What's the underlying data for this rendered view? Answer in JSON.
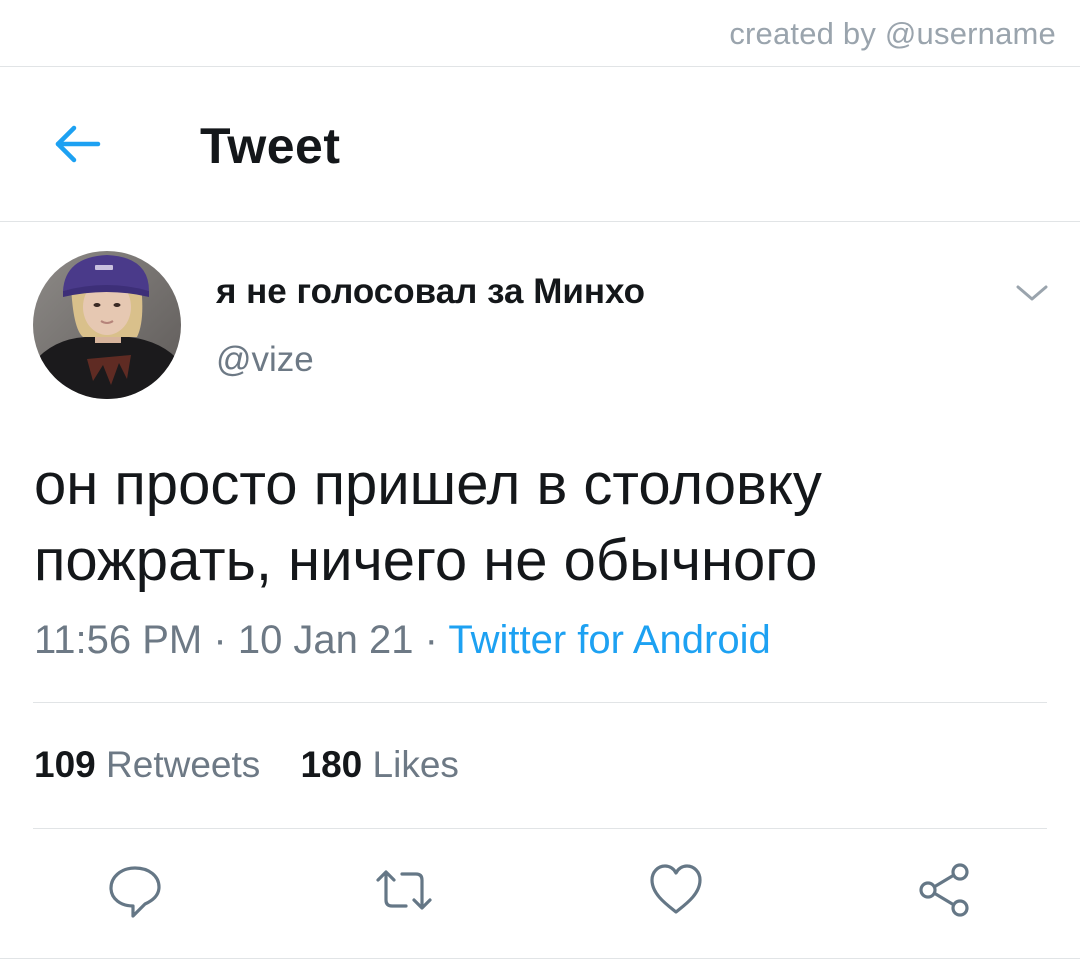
{
  "watermark": "created by @username",
  "header": {
    "back_icon": "arrow-left-icon",
    "title": "Tweet"
  },
  "tweet": {
    "author": {
      "display_name": "я не голосовал за Минхо",
      "handle": "@vize"
    },
    "text_lines": [
      "он просто пришел в столовку",
      "пожрать, ничего не обычного"
    ],
    "time": "11:56 PM",
    "date": "10 Jan 21",
    "source": "Twitter for Android",
    "separator": "·",
    "stats": {
      "retweets_count": "109",
      "retweets_label": "Retweets",
      "likes_count": "180",
      "likes_label": "Likes"
    },
    "actions": [
      {
        "name": "reply",
        "icon": "reply-bubble-icon"
      },
      {
        "name": "retweet",
        "icon": "retweet-icon"
      },
      {
        "name": "like",
        "icon": "heart-icon"
      },
      {
        "name": "share",
        "icon": "share-icon"
      }
    ]
  },
  "colors": {
    "accent": "#1da1f2",
    "text_primary": "#14171a",
    "text_secondary": "#6d7985",
    "divider": "#e1e4e6",
    "icon_gray": "#657786"
  }
}
